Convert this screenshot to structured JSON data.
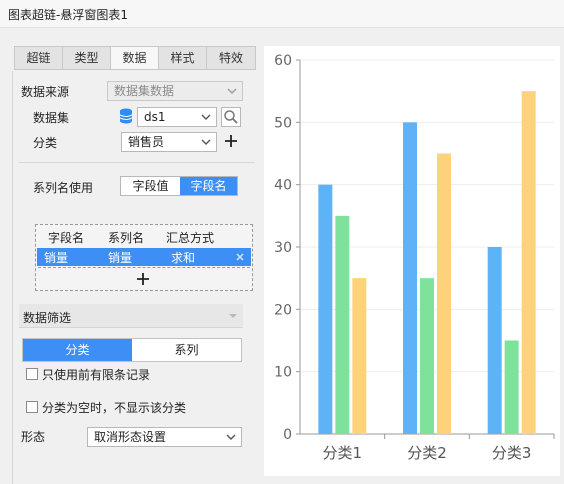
{
  "window": {
    "title": "图表超链-悬浮窗图表1"
  },
  "tabs": [
    {
      "label": "超链",
      "active": false
    },
    {
      "label": "类型",
      "active": false
    },
    {
      "label": "数据",
      "active": true
    },
    {
      "label": "样式",
      "active": false
    },
    {
      "label": "特效",
      "active": false
    }
  ],
  "data_source": {
    "label": "数据来源",
    "value": "数据集数据"
  },
  "dataset": {
    "label": "数据集",
    "value": "ds1",
    "icon": "database-icon",
    "search_icon": "search-icon"
  },
  "category": {
    "label": "分类",
    "value": "销售员",
    "add_icon": "plus-icon"
  },
  "series_name": {
    "label": "系列名使用",
    "options": [
      "字段值",
      "字段名"
    ],
    "selected": "字段名"
  },
  "field_table": {
    "headers": [
      "字段名",
      "系列名",
      "汇总方式"
    ],
    "rows": [
      {
        "field": "销量",
        "series": "销量",
        "summary": "求和"
      }
    ],
    "add_icon": "plus-icon",
    "remove_icon": "close-icon"
  },
  "data_filter": {
    "label": "数据筛选",
    "tabs": [
      "分类",
      "系列"
    ],
    "active_tab": "分类"
  },
  "options": {
    "limit_records": "只使用前有限条记录",
    "hide_empty": "分类为空时，不显示该分类"
  },
  "form": {
    "label": "形态",
    "value": "取消形态设置"
  },
  "colors": {
    "accent": "#3d8ff5",
    "bar_blue": "#5db3f5",
    "bar_green": "#7fe29a",
    "bar_yellow": "#fdd27a"
  },
  "chart_data": {
    "type": "bar",
    "categories": [
      "分类1",
      "分类2",
      "分类3"
    ],
    "series": [
      {
        "values": [
          40,
          50,
          30
        ],
        "color": "#5db3f5"
      },
      {
        "values": [
          35,
          25,
          15
        ],
        "color": "#7fe29a"
      },
      {
        "values": [
          25,
          45,
          55
        ],
        "color": "#fdd27a"
      }
    ],
    "ylim": [
      0,
      60
    ],
    "yticks": [
      "0",
      "10",
      "20",
      "30",
      "40",
      "50",
      "60"
    ],
    "grid": true,
    "legend": "none",
    "title": ""
  }
}
